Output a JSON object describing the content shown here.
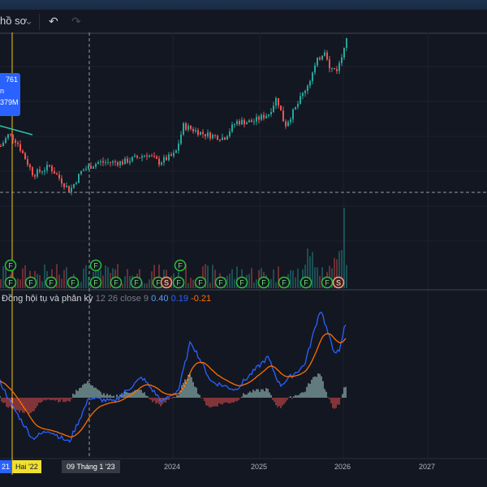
{
  "toolbar": {
    "profile_label": "hồ sơ",
    "undo_icon": "undo-icon",
    "redo_icon": "redo-icon"
  },
  "tooltip": {
    "value": "761",
    "line2": "n",
    "volume": "379M"
  },
  "macd_legend": {
    "name": "Đồng hội tụ và phân kỳ",
    "params": "12 26 close 9",
    "macd": "0.40",
    "signal": "0.19",
    "hist": "-0.21"
  },
  "colors": {
    "up": "#26a69a",
    "down": "#ef5350",
    "macd": "#2962ff",
    "signal": "#ff6d00",
    "crosshair": "#f0c419"
  },
  "time_axis": {
    "left_label": "21",
    "crosshair_label": "Hai '22",
    "cursor_label": "09 Tháng 1 '23",
    "ticks": [
      "2024",
      "2025",
      "2026",
      "2027"
    ]
  },
  "chart_data": {
    "type": "candlestick",
    "title": "",
    "price_path": [
      [
        0,
        220
      ],
      [
        10,
        235
      ],
      [
        20,
        225
      ],
      [
        40,
        185
      ],
      [
        60,
        195
      ],
      [
        85,
        165
      ],
      [
        100,
        190
      ],
      [
        120,
        200
      ],
      [
        150,
        200
      ],
      [
        180,
        210
      ],
      [
        195,
        200
      ],
      [
        215,
        210
      ],
      [
        225,
        245
      ],
      [
        250,
        235
      ],
      [
        275,
        230
      ],
      [
        290,
        250
      ],
      [
        310,
        250
      ],
      [
        330,
        260
      ],
      [
        340,
        280
      ],
      [
        350,
        245
      ],
      [
        365,
        270
      ],
      [
        380,
        300
      ],
      [
        390,
        325
      ],
      [
        400,
        340
      ],
      [
        405,
        315
      ],
      [
        415,
        315
      ],
      [
        420,
        330
      ],
      [
        425,
        355
      ]
    ],
    "macd_path": [
      [
        0,
        20
      ],
      [
        15,
        -10
      ],
      [
        40,
        -50
      ],
      [
        60,
        -40
      ],
      [
        85,
        -55
      ],
      [
        110,
        0
      ],
      [
        140,
        -5
      ],
      [
        175,
        25
      ],
      [
        200,
        -5
      ],
      [
        220,
        10
      ],
      [
        235,
        70
      ],
      [
        260,
        20
      ],
      [
        290,
        10
      ],
      [
        330,
        50
      ],
      [
        345,
        15
      ],
      [
        375,
        40
      ],
      [
        395,
        110
      ],
      [
        410,
        60
      ],
      [
        418,
        55
      ],
      [
        425,
        90
      ]
    ],
    "events": {
      "lower_F": [
        13,
        38,
        63,
        90,
        118,
        143,
        168,
        195,
        220,
        247,
        272,
        298,
        325,
        350,
        377,
        403
      ],
      "upper_F": [
        13,
        118,
        222
      ],
      "S": [
        205,
        417
      ]
    }
  }
}
